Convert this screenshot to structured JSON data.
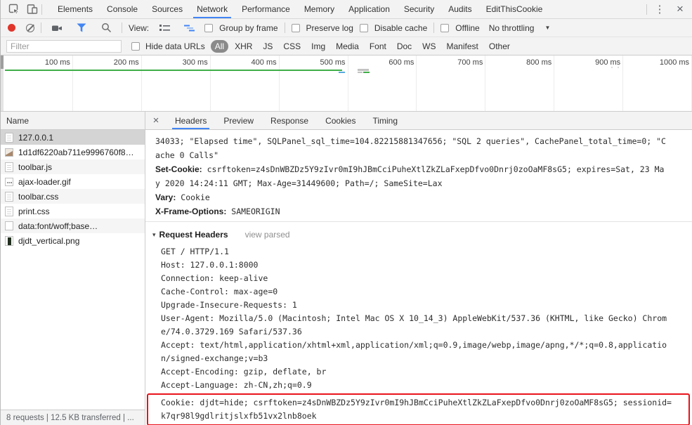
{
  "colors": {
    "accent_blue": "#4285f4",
    "record_red": "#e0352b",
    "overview_green": "#3fae49",
    "highlight_red": "#e9131c",
    "chrome_bg": "#f3f3f3",
    "selected_row": "#d4d4d4"
  },
  "icons": {
    "kebab_menu": "⋮",
    "close": "×",
    "details_close": "×",
    "dropdown_arrow": "▼",
    "disclosure_open": "▾"
  },
  "main_tabs": {
    "items": [
      {
        "label": "Elements",
        "selected": false
      },
      {
        "label": "Console",
        "selected": false
      },
      {
        "label": "Sources",
        "selected": false
      },
      {
        "label": "Network",
        "selected": true
      },
      {
        "label": "Performance",
        "selected": false
      },
      {
        "label": "Memory",
        "selected": false
      },
      {
        "label": "Application",
        "selected": false
      },
      {
        "label": "Security",
        "selected": false
      },
      {
        "label": "Audits",
        "selected": false
      },
      {
        "label": "EditThisCookie",
        "selected": false
      }
    ]
  },
  "toolbar": {
    "view_label": "View:",
    "group_by_frame_label": "Group by frame",
    "preserve_log_label": "Preserve log",
    "disable_cache_label": "Disable cache",
    "offline_label": "Offline",
    "throttling_value": "No throttling"
  },
  "filter_bar": {
    "placeholder": "Filter",
    "hide_data_urls_label": "Hide data URLs",
    "types": [
      {
        "label": "All",
        "selected": true
      },
      {
        "label": "XHR",
        "selected": false
      },
      {
        "label": "JS",
        "selected": false
      },
      {
        "label": "CSS",
        "selected": false
      },
      {
        "label": "Img",
        "selected": false
      },
      {
        "label": "Media",
        "selected": false
      },
      {
        "label": "Font",
        "selected": false
      },
      {
        "label": "Doc",
        "selected": false
      },
      {
        "label": "WS",
        "selected": false
      },
      {
        "label": "Manifest",
        "selected": false
      },
      {
        "label": "Other",
        "selected": false
      }
    ]
  },
  "timeline": {
    "ticks": [
      "100 ms",
      "200 ms",
      "300 ms",
      "400 ms",
      "500 ms",
      "600 ms",
      "700 ms",
      "800 ms",
      "900 ms",
      "1000 ms"
    ]
  },
  "sidebar": {
    "header": "Name",
    "requests": [
      {
        "name": "127.0.0.1",
        "icon": "doc",
        "selected": true
      },
      {
        "name": "1d1df6220ab711e9996760f8…",
        "icon": "img",
        "selected": false
      },
      {
        "name": "toolbar.js",
        "icon": "doc",
        "selected": false
      },
      {
        "name": "ajax-loader.gif",
        "icon": "gif",
        "selected": false
      },
      {
        "name": "toolbar.css",
        "icon": "doc",
        "selected": false
      },
      {
        "name": "print.css",
        "icon": "doc",
        "selected": false
      },
      {
        "name": "data:font/woff;base…",
        "icon": "blank",
        "selected": false
      },
      {
        "name": "djdt_vertical.png",
        "icon": "png",
        "selected": false
      }
    ],
    "status_text": "8 requests | 12.5 KB transferred | ..."
  },
  "details": {
    "tabs": [
      {
        "label": "Headers",
        "selected": true
      },
      {
        "label": "Preview",
        "selected": false
      },
      {
        "label": "Response",
        "selected": false
      },
      {
        "label": "Cookies",
        "selected": false
      },
      {
        "label": "Timing",
        "selected": false
      }
    ],
    "response_lines": [
      {
        "name": "",
        "value": "34033; \"Elapsed time\", SQLPanel_sql_time=104.82215881347656; \"SQL 2 queries\", CachePanel_total_time=0; \"C"
      },
      {
        "name": "",
        "value": "ache 0 Calls\""
      },
      {
        "name": "Set-Cookie:",
        "value": " csrftoken=z4sDnWBZDz5Y9zIvr0mI9hJBmCciPuheXtlZkZLaFxepDfvo0Dnrj0zoOaMF8sG5; expires=Sat, 23 Ma"
      },
      {
        "name": "",
        "value": "y 2020 14:24:11 GMT; Max-Age=31449600; Path=/; SameSite=Lax"
      },
      {
        "name": "Vary:",
        "value": " Cookie"
      },
      {
        "name": "X-Frame-Options:",
        "value": " SAMEORIGIN"
      }
    ],
    "request_headers": {
      "title": "Request Headers",
      "view_parsed_label": "view parsed",
      "lines": [
        "GET / HTTP/1.1",
        "Host: 127.0.0.1:8000",
        "Connection: keep-alive",
        "Cache-Control: max-age=0",
        "Upgrade-Insecure-Requests: 1",
        "User-Agent: Mozilla/5.0 (Macintosh; Intel Mac OS X 10_14_3) AppleWebKit/537.36 (KHTML, like Gecko) Chrom",
        "e/74.0.3729.169 Safari/537.36",
        "Accept: text/html,application/xhtml+xml,application/xml;q=0.9,image/webp,image/apng,*/*;q=0.8,applicatio",
        "n/signed-exchange;v=b3",
        "Accept-Encoding: gzip, deflate, br",
        "Accept-Language: zh-CN,zh;q=0.9"
      ],
      "cookie_box_lines": [
        "Cookie: djdt=hide; csrftoken=z4sDnWBZDz5Y9zIvr0mI9hJBmCciPuheXtlZkZLaFxepDfvo0Dnrj0zoOaMF8sG5; sessionid=",
        "k7qr98l9gdlritjslxfb51vx2lnb8oek"
      ]
    }
  }
}
